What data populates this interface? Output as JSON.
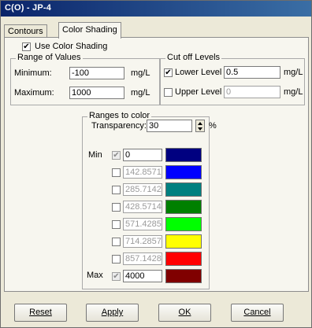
{
  "window": {
    "title": "C(O) - JP-4"
  },
  "tabs": [
    {
      "label": "Contours",
      "active": false
    },
    {
      "label": "Color Shading",
      "active": true
    }
  ],
  "use_color_shading": {
    "label": "Use Color Shading",
    "checked": true
  },
  "range_of_values": {
    "title": "Range of Values",
    "minimum": {
      "label": "Minimum:",
      "value": "-100",
      "unit": "mg/L"
    },
    "maximum": {
      "label": "Maximum:",
      "value": "1000",
      "unit": "mg/L"
    }
  },
  "cut_off_levels": {
    "title": "Cut off Levels",
    "lower": {
      "label": "Lower Level",
      "checked": true,
      "value": "0.5",
      "unit": "mg/L"
    },
    "upper": {
      "label": "Upper Level",
      "checked": false,
      "value": "0",
      "unit": "mg/L"
    }
  },
  "ranges_to_color": {
    "title": "Ranges to color",
    "transparency": {
      "label": "Transparency:",
      "value": "30",
      "unit": "%"
    },
    "min_label": "Min",
    "max_label": "Max",
    "rows": [
      {
        "value": "0",
        "color": "#000080",
        "checked": true,
        "disabled": true,
        "editable": true
      },
      {
        "value": "142.85714286",
        "color": "#0000ff",
        "checked": false,
        "disabled": false,
        "editable": false
      },
      {
        "value": "285.71428571",
        "color": "#008080",
        "checked": false,
        "disabled": false,
        "editable": false
      },
      {
        "value": "428.57142857",
        "color": "#008000",
        "checked": false,
        "disabled": false,
        "editable": false
      },
      {
        "value": "571.42857143",
        "color": "#00ff00",
        "checked": false,
        "disabled": false,
        "editable": false
      },
      {
        "value": "714.28571429",
        "color": "#ffff00",
        "checked": false,
        "disabled": false,
        "editable": false
      },
      {
        "value": "857.14285714",
        "color": "#ff0000",
        "checked": false,
        "disabled": false,
        "editable": false
      },
      {
        "value": "4000",
        "color": "#800000",
        "checked": true,
        "disabled": true,
        "editable": true
      }
    ]
  },
  "buttons": {
    "reset": "Reset",
    "apply": "Apply",
    "ok": "OK",
    "cancel": "Cancel"
  }
}
